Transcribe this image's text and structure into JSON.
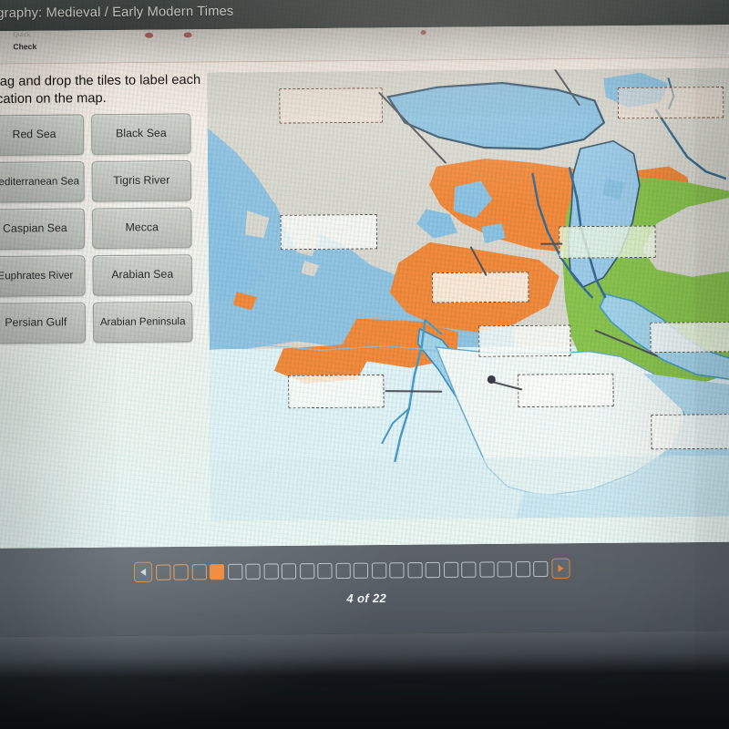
{
  "window": {
    "title": "eography: Medieval / Early Modern Times"
  },
  "toolbar": {
    "quick_label": "Quick",
    "check_label": "Check"
  },
  "instructions": {
    "text": "Drag and drop the tiles to label each location on the map."
  },
  "tiles": [
    {
      "label": "Red Sea"
    },
    {
      "label": "Black Sea"
    },
    {
      "label": "Mediterranean Sea"
    },
    {
      "label": "Tigris River"
    },
    {
      "label": "Caspian Sea"
    },
    {
      "label": "Mecca"
    },
    {
      "label": "Euphrates River"
    },
    {
      "label": "Arabian Sea"
    },
    {
      "label": "Persian Gulf"
    },
    {
      "label": "Arabian Peninsula"
    }
  ],
  "map": {
    "alt": "Middle East and Mediterranean region political map",
    "dropzones": [
      {
        "id": "dz-black-sea",
        "value": ""
      },
      {
        "id": "dz-caspian",
        "value": ""
      },
      {
        "id": "dz-med-sea",
        "value": ""
      },
      {
        "id": "dz-persia",
        "value": ""
      },
      {
        "id": "dz-tigris",
        "value": ""
      },
      {
        "id": "dz-euphrates",
        "value": ""
      },
      {
        "id": "dz-red-sea",
        "value": ""
      },
      {
        "id": "dz-mecca",
        "value": ""
      },
      {
        "id": "dz-persian-gulf",
        "value": ""
      },
      {
        "id": "dz-arabian-sea",
        "value": ""
      }
    ],
    "colors": {
      "land": "#ddd9d0",
      "water": "#8ec3e3",
      "ocean_light": "#cfe8f4",
      "ottoman": "#f58a3c",
      "safavid": "#8cc44f",
      "border": "#3a5a70"
    }
  },
  "pagination": {
    "prev_label": "Previous",
    "next_label": "Next",
    "current": 4,
    "total": 22,
    "status": "4 of 22",
    "squares": [
      {
        "state": "done"
      },
      {
        "state": "done"
      },
      {
        "state": "done"
      },
      {
        "state": "cur"
      },
      {
        "state": "todo"
      },
      {
        "state": "todo"
      },
      {
        "state": "todo"
      },
      {
        "state": "todo"
      },
      {
        "state": "todo"
      },
      {
        "state": "todo"
      },
      {
        "state": "todo"
      },
      {
        "state": "todo"
      },
      {
        "state": "todo"
      },
      {
        "state": "todo"
      },
      {
        "state": "todo"
      },
      {
        "state": "todo"
      },
      {
        "state": "todo"
      },
      {
        "state": "todo"
      },
      {
        "state": "todo"
      },
      {
        "state": "todo"
      },
      {
        "state": "todo"
      },
      {
        "state": "todo"
      }
    ]
  },
  "accent": {
    "orange": "#f4842f",
    "orange_outline": "#e09a5e",
    "bar": "#565c63"
  }
}
